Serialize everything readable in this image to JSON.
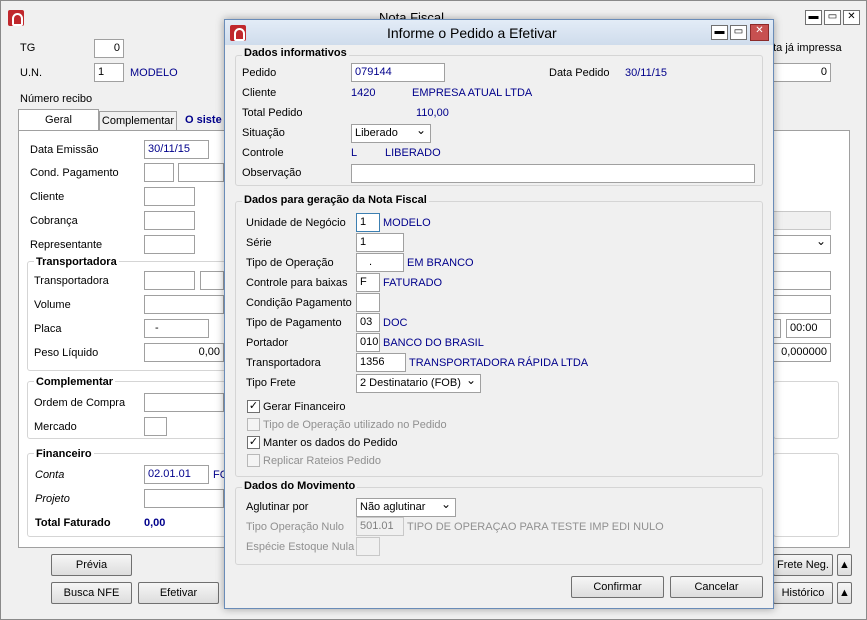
{
  "main": {
    "title": "Nota Fiscal",
    "tg_label": "TG",
    "tg_value": "0",
    "un_label": "U.N.",
    "un_value": "1",
    "un_name": "MODELO",
    "numero_recibo_label": "Número recibo",
    "nota_impressa_label": "ota já impressa",
    "right_num_value": "0",
    "tabs": [
      "Geral",
      "Complementar",
      "O siste"
    ],
    "data_emissao_label": "Data Emissão",
    "data_emissao_value": "30/11/15",
    "cond_pagamento_label": "Cond. Pagamento",
    "cliente_label": "Cliente",
    "cobranca_label": "Cobrança",
    "representante_label": "Representante",
    "transportadora_group": "Transportadora",
    "transportadora_label": "Transportadora",
    "volume_label": "Volume",
    "placa_label": "Placa",
    "placa_value": "-",
    "peso_liquido_label": "Peso Líquido",
    "peso_liquido_value": "0,00",
    "right_time_value": "00:00",
    "right_amount_value": "0,000000",
    "complementar_group": "Complementar",
    "ordem_compra_label": "Ordem de Compra",
    "mercado_label": "Mercado",
    "financeiro_group": "Financeiro",
    "conta_label": "Conta",
    "conta_value": "02.01.01",
    "conta_suffix": "FC",
    "projeto_label": "Projeto",
    "total_faturado_label": "Total Faturado",
    "total_faturado_value": "0,00",
    "btn_previa": "Prévia",
    "btn_busca_nfe": "Busca NFE",
    "btn_efetivar": "Efetivar",
    "btn_frete_neg": "Frete Neg.",
    "btn_historico": "Histórico"
  },
  "dialog": {
    "title": "Informe o Pedido a Efetivar",
    "sec1": "Dados informativos",
    "pedido_label": "Pedido",
    "pedido_value": "079144",
    "data_pedido_label": "Data Pedido",
    "data_pedido_value": "30/11/15",
    "cliente_label": "Cliente",
    "cliente_code": "1420",
    "cliente_name": "EMPRESA ATUAL LTDA",
    "total_pedido_label": "Total Pedido",
    "total_pedido_value": "110,00",
    "situacao_label": "Situação",
    "situacao_value": "Liberado",
    "controle_label": "Controle",
    "controle_code": "L",
    "controle_name": "LIBERADO",
    "observacao_label": "Observação",
    "sec2": "Dados para geração da Nota Fiscal",
    "unidade_label": "Unidade de Negócio",
    "unidade_value": "1",
    "unidade_name": "MODELO",
    "serie_label": "Série",
    "serie_value": "1",
    "tipo_operacao_label": "Tipo de Operação",
    "tipo_operacao_value": ".",
    "tipo_operacao_name": "EM BRANCO",
    "controle_baixas_label": "Controle para baixas",
    "controle_baixas_value": "F",
    "controle_baixas_name": "FATURADO",
    "condicao_pagamento_label": "Condição Pagamento",
    "tipo_pagamento_label": "Tipo de Pagamento",
    "tipo_pagamento_value": "03",
    "tipo_pagamento_name": "DOC",
    "portador_label": "Portador",
    "portador_value": "010",
    "portador_name": "BANCO DO BRASIL",
    "transportadora_label": "Transportadora",
    "transportadora_value": "1356",
    "transportadora_name": "TRANSPORTADORA RÁPIDA LTDA",
    "tipo_frete_label": "Tipo Frete",
    "tipo_frete_value": "2 Destinatario (FOB)",
    "cb_gerar_financeiro": "Gerar Financeiro",
    "cb_tipo_operacao_pedido": "Tipo de Operação utilizado no Pedido",
    "cb_manter_dados": "Manter os dados do Pedido",
    "cb_replicar_rateios": "Replicar Rateios Pedido",
    "sec3": "Dados do Movimento",
    "aglutinar_label": "Aglutinar por",
    "aglutinar_value": "Não aglutinar",
    "tipo_op_nulo_label": "Tipo Operação Nulo",
    "tipo_op_nulo_value": "501.01",
    "tipo_op_nulo_name": "TIPO DE OPERAÇAO PARA TESTE IMP EDI NULO",
    "especie_estoque_label": "Espécie Estoque Nula",
    "btn_confirmar": "Confirmar",
    "btn_cancelar": "Cancelar"
  }
}
